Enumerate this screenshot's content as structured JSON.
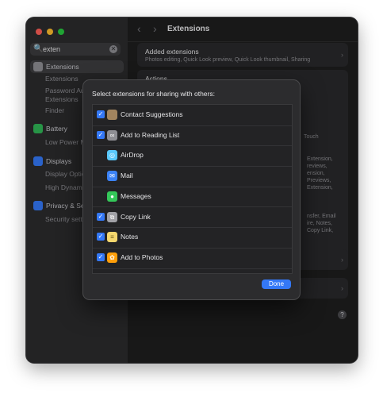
{
  "window": {
    "traffic_colors": [
      "#fe5f57",
      "#febc2e",
      "#28c840"
    ],
    "title": "Extensions"
  },
  "search": {
    "value": "exten",
    "mag_icon": "🔍",
    "clear_icon": "✕"
  },
  "sidebar": {
    "extensions": {
      "label": "Extensions",
      "icon_color": "#8e8e93"
    },
    "extensions_subs": [
      "Extensions",
      "Password AutoFill Extensions",
      "Finder"
    ],
    "battery": {
      "label": "Battery",
      "icon_color": "#30b556"
    },
    "battery_subs": [
      "Low Power Mode"
    ],
    "displays": {
      "label": "Displays",
      "icon_color": "#3478f6"
    },
    "displays_subs": [
      "Display Options",
      "High Dynamic Range"
    ],
    "privacy": {
      "label": "Privacy & Security",
      "icon_color": "#3478f6"
    },
    "privacy_subs": [
      "Security settings"
    ]
  },
  "main": {
    "back_icon": "‹",
    "forward_icon": "›",
    "added_title": "Added extensions",
    "added_sub": "Photos editing, Quick Look preview, Quick Look thumbnail, Sharing",
    "actions_title": "Actions",
    "ghost_1": "Touch",
    "ghost_2": [
      "Extension,",
      "reviews,",
      "ension,",
      "Previews,",
      "Extension,"
    ],
    "ghost_3": [
      "nsfer, Email",
      "ire, Notes,",
      "Copy Link,"
    ],
    "chevron": "›",
    "help": "?"
  },
  "sheet": {
    "title": "Select extensions for sharing with others:",
    "check": "✓",
    "items": [
      {
        "label": "Contact Suggestions",
        "checked": true,
        "icon_color": "#a2845e",
        "glyph": ""
      },
      {
        "label": "Add to Reading List",
        "checked": true,
        "icon_color": "#8e8e93",
        "glyph": "∞"
      },
      {
        "label": "AirDrop",
        "checked": false,
        "icon_color": "#5ac8fa",
        "glyph": "◎"
      },
      {
        "label": "Mail",
        "checked": false,
        "icon_color": "#3b82f6",
        "glyph": "✉"
      },
      {
        "label": "Messages",
        "checked": false,
        "icon_color": "#34c759",
        "glyph": "●"
      },
      {
        "label": "Copy Link",
        "checked": true,
        "icon_color": "#a1a1a6",
        "glyph": "⧉"
      },
      {
        "label": "Notes",
        "checked": true,
        "icon_color": "#f5d76e",
        "glyph": "≡"
      },
      {
        "label": "Add to Photos",
        "checked": true,
        "icon_color": "#ff9f0a",
        "glyph": "✿"
      }
    ],
    "done_label": "Done"
  }
}
